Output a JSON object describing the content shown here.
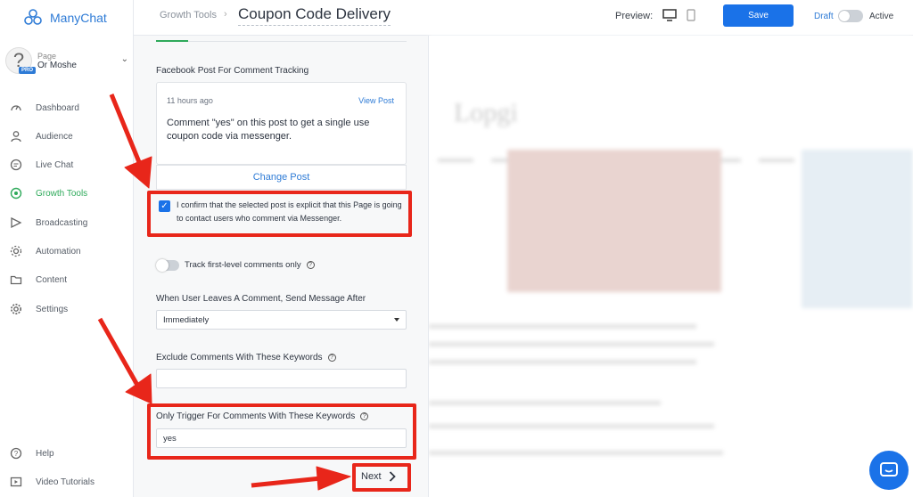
{
  "app": {
    "name": "ManyChat"
  },
  "page_selector": {
    "label": "Page",
    "name": "Or Moshe",
    "badge": "PRO"
  },
  "sidebar": {
    "items": [
      {
        "label": "Dashboard",
        "icon": "gauge-icon"
      },
      {
        "label": "Audience",
        "icon": "person-icon"
      },
      {
        "label": "Live Chat",
        "icon": "chat-icon"
      },
      {
        "label": "Growth Tools",
        "icon": "growth-icon",
        "active": true
      },
      {
        "label": "Broadcasting",
        "icon": "send-icon"
      },
      {
        "label": "Automation",
        "icon": "automation-icon"
      },
      {
        "label": "Content",
        "icon": "folder-icon"
      },
      {
        "label": "Settings",
        "icon": "gear-icon"
      }
    ],
    "bottom_items": [
      {
        "label": "Help",
        "icon": "help-icon"
      },
      {
        "label": "Video Tutorials",
        "icon": "video-icon"
      }
    ]
  },
  "header": {
    "breadcrumb": "Growth Tools",
    "title": "Coupon Code Delivery",
    "preview_label": "Preview:",
    "save_label": "Save",
    "draft_label": "Draft",
    "active_label": "Active"
  },
  "form": {
    "post_section_label": "Facebook Post For Comment Tracking",
    "post_time": "11 hours ago",
    "view_post_label": "View Post",
    "post_text": "Comment \"yes\" on this post to get a single use coupon code via messenger.",
    "change_post_label": "Change Post",
    "confirm_text": "I confirm that the selected post is explicit that this Page is going to contact users who comment via Messenger.",
    "confirm_checked": true,
    "track_label": "Track first-level comments only",
    "track_enabled": false,
    "send_after_label": "When User Leaves A Comment, Send Message After",
    "send_after_value": "Immediately",
    "exclude_label": "Exclude Comments With These Keywords",
    "exclude_value": "",
    "only_trigger_label": "Only Trigger For Comments With These Keywords",
    "only_trigger_value": "yes",
    "next_label": "Next"
  },
  "colors": {
    "accent": "#1a72e8",
    "active_nav": "#2faa5b",
    "annotation": "#e8261a"
  }
}
